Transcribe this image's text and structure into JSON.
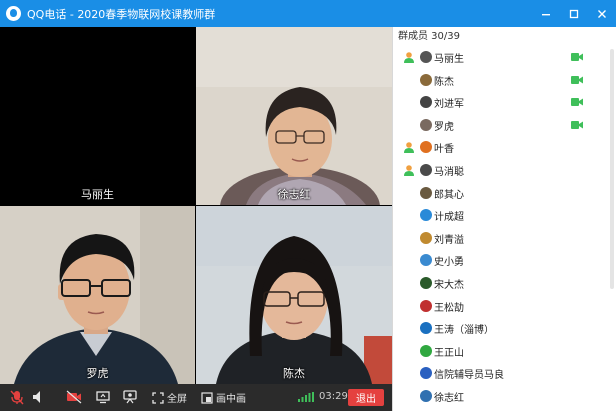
{
  "window": {
    "app": "QQ电话",
    "separator": "-",
    "group": "2020春季物联网校课教师群",
    "colors": {
      "titlebar": "#1a8ee6",
      "toolbar": "#2b2b2b",
      "exit": "#e5413f",
      "camera": "#3fbf5a"
    }
  },
  "video": {
    "tiles": [
      {
        "name": "马丽生",
        "camera": "off"
      },
      {
        "name": "徐志红",
        "camera": "on"
      },
      {
        "name": "罗虎",
        "camera": "on"
      },
      {
        "name": "陈杰",
        "camera": "on"
      }
    ]
  },
  "toolbar": {
    "mic_icon": "mic-muted-icon",
    "speaker_icon": "speaker-icon",
    "camera_icon": "camera-off-icon",
    "share_icon": "screen-share-icon",
    "whiteboard_icon": "presenter-icon",
    "fullscreen_label": "全屏",
    "pip_label": "画中画",
    "signal_icon": "signal-icon",
    "timer": "03:29",
    "exit_label": "退出"
  },
  "panel": {
    "title": "群成员 30/39",
    "members": [
      {
        "name": "马丽生",
        "role": "admin",
        "camera": true,
        "avatar": "#555555"
      },
      {
        "name": "陈杰",
        "role": "",
        "camera": true,
        "avatar": "#8a6a3a"
      },
      {
        "name": "刘进军",
        "role": "",
        "camera": true,
        "avatar": "#444444"
      },
      {
        "name": "罗虎",
        "role": "",
        "camera": true,
        "avatar": "#7a6a60"
      },
      {
        "name": "叶香",
        "role": "admin",
        "camera": false,
        "avatar": "#e07020"
      },
      {
        "name": "马消聪",
        "role": "admin",
        "camera": false,
        "avatar": "#4a4a4a"
      },
      {
        "name": "郎其心",
        "role": "",
        "camera": false,
        "avatar": "#6a5a40"
      },
      {
        "name": "计成超",
        "role": "",
        "camera": false,
        "avatar": "#2a8ad8"
      },
      {
        "name": "刘青溢",
        "role": "",
        "camera": false,
        "avatar": "#c08a30"
      },
      {
        "name": "史小勇",
        "role": "",
        "camera": false,
        "avatar": "#3a8ad0"
      },
      {
        "name": "宋大杰",
        "role": "",
        "camera": false,
        "avatar": "#2a5a2a"
      },
      {
        "name": "王松劼",
        "role": "",
        "camera": false,
        "avatar": "#c03030"
      },
      {
        "name": "王涛（淄博）",
        "role": "",
        "camera": false,
        "avatar": "#1a70c0"
      },
      {
        "name": "王正山",
        "role": "",
        "camera": false,
        "avatar": "#30a840"
      },
      {
        "name": "信院辅导员马良",
        "role": "",
        "camera": false,
        "avatar": "#2a60c0"
      },
      {
        "name": "徐志红",
        "role": "",
        "camera": false,
        "avatar": "#3070b0"
      }
    ]
  }
}
